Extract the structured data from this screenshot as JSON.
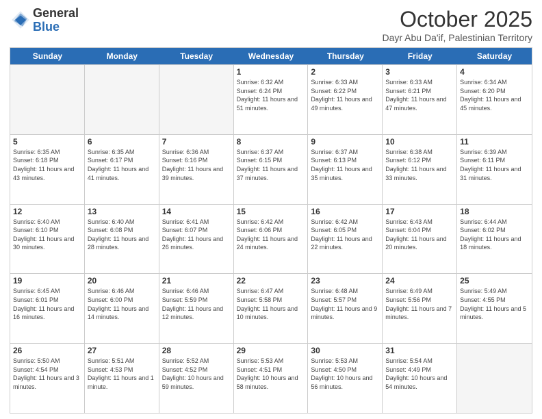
{
  "header": {
    "logo_general": "General",
    "logo_blue": "Blue",
    "month_title": "October 2025",
    "subtitle": "Dayr Abu Da'if, Palestinian Territory"
  },
  "days_of_week": [
    "Sunday",
    "Monday",
    "Tuesday",
    "Wednesday",
    "Thursday",
    "Friday",
    "Saturday"
  ],
  "weeks": [
    [
      {
        "day": "",
        "info": "",
        "empty": true
      },
      {
        "day": "",
        "info": "",
        "empty": true
      },
      {
        "day": "",
        "info": "",
        "empty": true
      },
      {
        "day": "1",
        "info": "Sunrise: 6:32 AM\nSunset: 6:24 PM\nDaylight: 11 hours\nand 51 minutes.",
        "empty": false
      },
      {
        "day": "2",
        "info": "Sunrise: 6:33 AM\nSunset: 6:22 PM\nDaylight: 11 hours\nand 49 minutes.",
        "empty": false
      },
      {
        "day": "3",
        "info": "Sunrise: 6:33 AM\nSunset: 6:21 PM\nDaylight: 11 hours\nand 47 minutes.",
        "empty": false
      },
      {
        "day": "4",
        "info": "Sunrise: 6:34 AM\nSunset: 6:20 PM\nDaylight: 11 hours\nand 45 minutes.",
        "empty": false
      }
    ],
    [
      {
        "day": "5",
        "info": "Sunrise: 6:35 AM\nSunset: 6:18 PM\nDaylight: 11 hours\nand 43 minutes.",
        "empty": false
      },
      {
        "day": "6",
        "info": "Sunrise: 6:35 AM\nSunset: 6:17 PM\nDaylight: 11 hours\nand 41 minutes.",
        "empty": false
      },
      {
        "day": "7",
        "info": "Sunrise: 6:36 AM\nSunset: 6:16 PM\nDaylight: 11 hours\nand 39 minutes.",
        "empty": false
      },
      {
        "day": "8",
        "info": "Sunrise: 6:37 AM\nSunset: 6:15 PM\nDaylight: 11 hours\nand 37 minutes.",
        "empty": false
      },
      {
        "day": "9",
        "info": "Sunrise: 6:37 AM\nSunset: 6:13 PM\nDaylight: 11 hours\nand 35 minutes.",
        "empty": false
      },
      {
        "day": "10",
        "info": "Sunrise: 6:38 AM\nSunset: 6:12 PM\nDaylight: 11 hours\nand 33 minutes.",
        "empty": false
      },
      {
        "day": "11",
        "info": "Sunrise: 6:39 AM\nSunset: 6:11 PM\nDaylight: 11 hours\nand 31 minutes.",
        "empty": false
      }
    ],
    [
      {
        "day": "12",
        "info": "Sunrise: 6:40 AM\nSunset: 6:10 PM\nDaylight: 11 hours\nand 30 minutes.",
        "empty": false
      },
      {
        "day": "13",
        "info": "Sunrise: 6:40 AM\nSunset: 6:08 PM\nDaylight: 11 hours\nand 28 minutes.",
        "empty": false
      },
      {
        "day": "14",
        "info": "Sunrise: 6:41 AM\nSunset: 6:07 PM\nDaylight: 11 hours\nand 26 minutes.",
        "empty": false
      },
      {
        "day": "15",
        "info": "Sunrise: 6:42 AM\nSunset: 6:06 PM\nDaylight: 11 hours\nand 24 minutes.",
        "empty": false
      },
      {
        "day": "16",
        "info": "Sunrise: 6:42 AM\nSunset: 6:05 PM\nDaylight: 11 hours\nand 22 minutes.",
        "empty": false
      },
      {
        "day": "17",
        "info": "Sunrise: 6:43 AM\nSunset: 6:04 PM\nDaylight: 11 hours\nand 20 minutes.",
        "empty": false
      },
      {
        "day": "18",
        "info": "Sunrise: 6:44 AM\nSunset: 6:02 PM\nDaylight: 11 hours\nand 18 minutes.",
        "empty": false
      }
    ],
    [
      {
        "day": "19",
        "info": "Sunrise: 6:45 AM\nSunset: 6:01 PM\nDaylight: 11 hours\nand 16 minutes.",
        "empty": false
      },
      {
        "day": "20",
        "info": "Sunrise: 6:46 AM\nSunset: 6:00 PM\nDaylight: 11 hours\nand 14 minutes.",
        "empty": false
      },
      {
        "day": "21",
        "info": "Sunrise: 6:46 AM\nSunset: 5:59 PM\nDaylight: 11 hours\nand 12 minutes.",
        "empty": false
      },
      {
        "day": "22",
        "info": "Sunrise: 6:47 AM\nSunset: 5:58 PM\nDaylight: 11 hours\nand 10 minutes.",
        "empty": false
      },
      {
        "day": "23",
        "info": "Sunrise: 6:48 AM\nSunset: 5:57 PM\nDaylight: 11 hours\nand 9 minutes.",
        "empty": false
      },
      {
        "day": "24",
        "info": "Sunrise: 6:49 AM\nSunset: 5:56 PM\nDaylight: 11 hours\nand 7 minutes.",
        "empty": false
      },
      {
        "day": "25",
        "info": "Sunrise: 5:49 AM\nSunset: 4:55 PM\nDaylight: 11 hours\nand 5 minutes.",
        "empty": false
      }
    ],
    [
      {
        "day": "26",
        "info": "Sunrise: 5:50 AM\nSunset: 4:54 PM\nDaylight: 11 hours\nand 3 minutes.",
        "empty": false
      },
      {
        "day": "27",
        "info": "Sunrise: 5:51 AM\nSunset: 4:53 PM\nDaylight: 11 hours\nand 1 minute.",
        "empty": false
      },
      {
        "day": "28",
        "info": "Sunrise: 5:52 AM\nSunset: 4:52 PM\nDaylight: 10 hours\nand 59 minutes.",
        "empty": false
      },
      {
        "day": "29",
        "info": "Sunrise: 5:53 AM\nSunset: 4:51 PM\nDaylight: 10 hours\nand 58 minutes.",
        "empty": false
      },
      {
        "day": "30",
        "info": "Sunrise: 5:53 AM\nSunset: 4:50 PM\nDaylight: 10 hours\nand 56 minutes.",
        "empty": false
      },
      {
        "day": "31",
        "info": "Sunrise: 5:54 AM\nSunset: 4:49 PM\nDaylight: 10 hours\nand 54 minutes.",
        "empty": false
      },
      {
        "day": "",
        "info": "",
        "empty": true
      }
    ]
  ]
}
